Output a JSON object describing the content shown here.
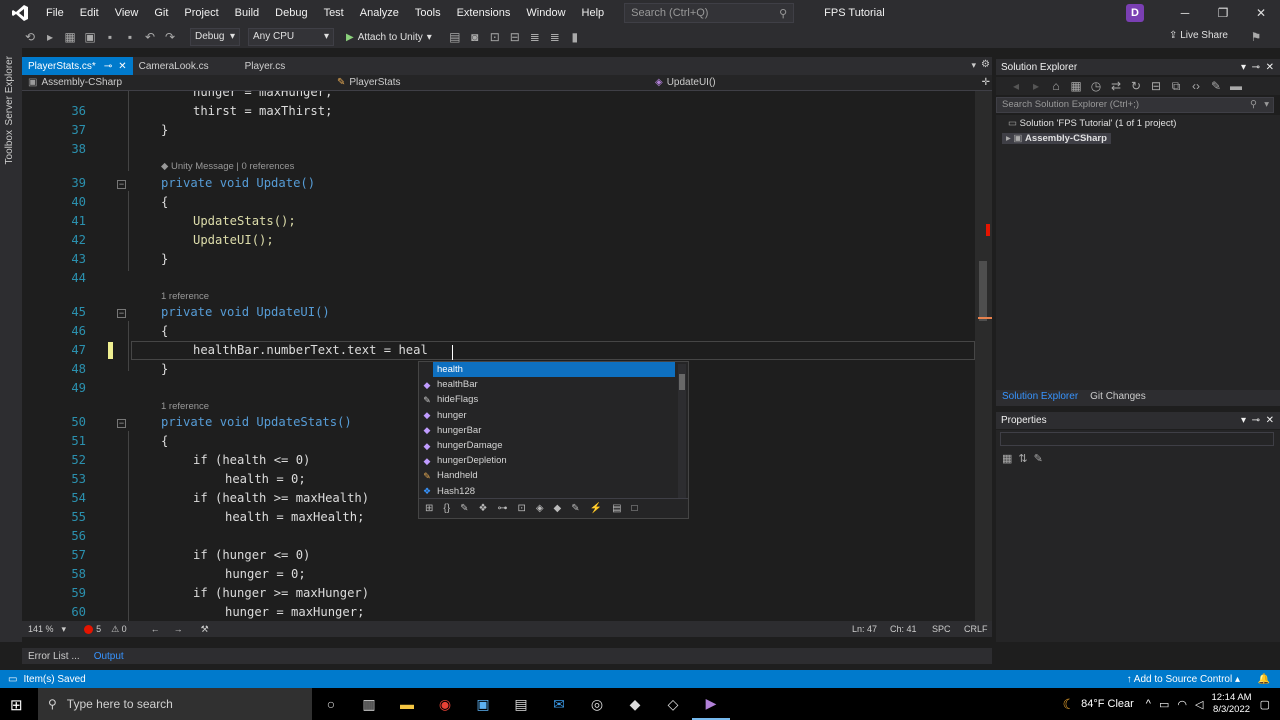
{
  "menu": [
    "File",
    "Edit",
    "View",
    "Git",
    "Project",
    "Build",
    "Debug",
    "Test",
    "Analyze",
    "Tools",
    "Extensions",
    "Window",
    "Help"
  ],
  "search_placeholder": "Search (Ctrl+Q)",
  "project_title": "FPS Tutorial",
  "user_initial": "D",
  "toolbar": {
    "config": "Debug",
    "platform": "Any CPU",
    "attach": "Attach to Unity",
    "live_share": "Live Share"
  },
  "left_tabs": [
    "Server Explorer",
    "Toolbox"
  ],
  "doc_tabs": [
    {
      "label": "PlayerStats.cs*",
      "active": true
    },
    {
      "label": "CameraLook.cs",
      "active": false
    },
    {
      "label": "Player.cs",
      "active": false
    }
  ],
  "nav": {
    "project": "Assembly-CSharp",
    "class": "PlayerStats",
    "member": "UpdateUI()"
  },
  "code": {
    "lines": [
      {
        "n": "",
        "text": "hunger = maxHunger;"
      },
      {
        "n": "36",
        "text": "thirst = maxThirst;"
      },
      {
        "n": "37",
        "text": "}"
      },
      {
        "n": "38",
        "text": ""
      },
      {
        "n": "39",
        "text": "private void Update()"
      },
      {
        "n": "40",
        "text": "{"
      },
      {
        "n": "41",
        "text": "UpdateStats();"
      },
      {
        "n": "42",
        "text": "UpdateUI();"
      },
      {
        "n": "43",
        "text": "}"
      },
      {
        "n": "44",
        "text": ""
      },
      {
        "n": "45",
        "text": "private void UpdateUI()"
      },
      {
        "n": "46",
        "text": "{"
      },
      {
        "n": "47",
        "text": "healthBar.numberText.text = heal"
      },
      {
        "n": "48",
        "text": "}"
      },
      {
        "n": "49",
        "text": ""
      },
      {
        "n": "50",
        "text": "private void UpdateStats()"
      },
      {
        "n": "51",
        "text": "{"
      },
      {
        "n": "52",
        "text": "if (health <= 0)"
      },
      {
        "n": "53",
        "text": "health = 0;"
      },
      {
        "n": "54",
        "text": "if (health >= maxHealth)"
      },
      {
        "n": "55",
        "text": "health = maxHealth;"
      },
      {
        "n": "56",
        "text": ""
      },
      {
        "n": "57",
        "text": "if (hunger <= 0)"
      },
      {
        "n": "58",
        "text": "hunger = 0;"
      },
      {
        "n": "59",
        "text": "if (hunger >= maxHunger)"
      },
      {
        "n": "60",
        "text": "hunger = maxHunger;"
      }
    ],
    "lens_unity": "Unity Message | 0 references",
    "lens_ref1": "1 reference",
    "lens_ref2": "1 reference"
  },
  "intellisense": {
    "items": [
      "health",
      "healthBar",
      "hideFlags",
      "hunger",
      "hungerBar",
      "hungerDamage",
      "hungerDepletion",
      "Handheld",
      "Hash128"
    ],
    "selected": 0
  },
  "editor_status": {
    "zoom": "141 %",
    "errors": "5",
    "warnings": "0",
    "line": "Ln: 47",
    "col": "Ch: 41",
    "spc": "SPC",
    "crlf": "CRLF"
  },
  "solution": {
    "header": "Solution Explorer",
    "search": "Search Solution Explorer (Ctrl+;)",
    "root": "Solution 'FPS Tutorial' (1 of 1 project)",
    "project": "Assembly-CSharp",
    "tabs": [
      "Solution Explorer",
      "Git Changes"
    ]
  },
  "properties": {
    "header": "Properties"
  },
  "bottom_tabs": [
    "Error List ...",
    "Output"
  ],
  "status": {
    "left": "Item(s) Saved",
    "right": "Add to Source Control"
  },
  "taskbar": {
    "search": "Type here to search",
    "weather": "84°F  Clear",
    "time": "12:14 AM",
    "date": "8/3/2022"
  }
}
